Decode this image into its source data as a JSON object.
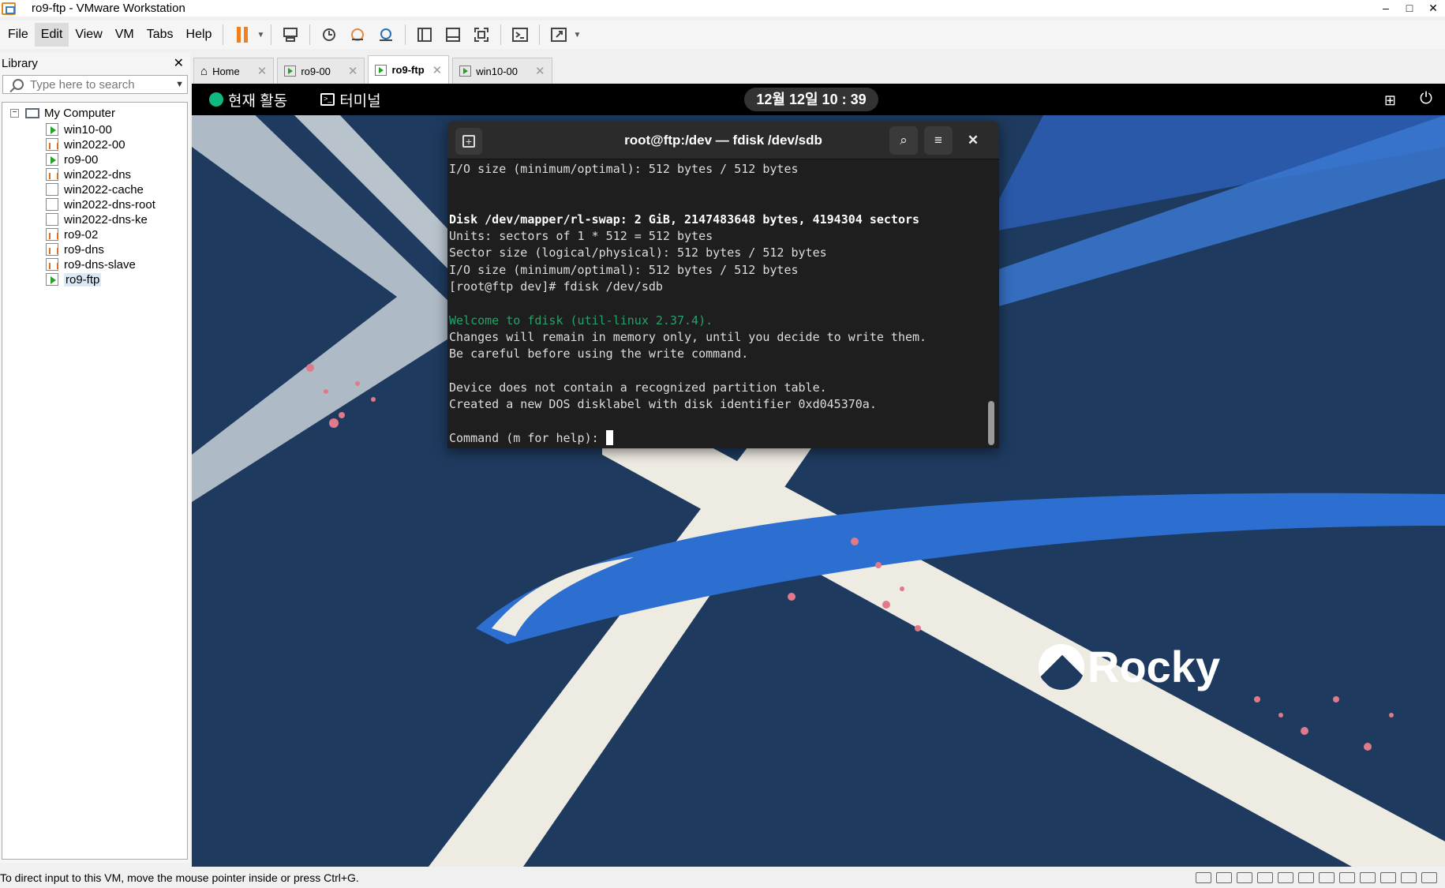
{
  "window": {
    "title": "ro9-ftp - VMware Workstation",
    "minimize": "–",
    "maximize": "□",
    "close": "✕"
  },
  "menu": [
    "File",
    "Edit",
    "View",
    "VM",
    "Tabs",
    "Help"
  ],
  "library": {
    "title": "Library",
    "close": "✕",
    "search_placeholder": "Type here to search",
    "root": "My Computer",
    "items": [
      {
        "label": "win10-00",
        "state": "running"
      },
      {
        "label": "win2022-00",
        "state": "off"
      },
      {
        "label": "ro9-00",
        "state": "running"
      },
      {
        "label": "win2022-dns",
        "state": "off"
      },
      {
        "label": "win2022-cache",
        "state": "none"
      },
      {
        "label": "win2022-dns-root",
        "state": "none"
      },
      {
        "label": "win2022-dns-ke",
        "state": "none"
      },
      {
        "label": "ro9-02",
        "state": "off"
      },
      {
        "label": "ro9-dns",
        "state": "off"
      },
      {
        "label": "ro9-dns-slave",
        "state": "off"
      },
      {
        "label": "ro9-ftp",
        "state": "running"
      }
    ]
  },
  "tabs": [
    {
      "label": "Home"
    },
    {
      "label": "ro9-00"
    },
    {
      "label": "ro9-ftp"
    },
    {
      "label": "win10-00"
    }
  ],
  "gnome": {
    "activities": "현재 활동",
    "app": "터미널",
    "clock": "12월 12일  10 : 39"
  },
  "terminal": {
    "title": "root@ftp:/dev — fdisk /dev/sdb",
    "lines": [
      {
        "text": "I/O size (minimum/optimal): 512 bytes / 512 bytes",
        "style": ""
      },
      {
        "text": "",
        "style": ""
      },
      {
        "text": "",
        "style": ""
      },
      {
        "text": "Disk /dev/mapper/rl-swap: 2 GiB, 2147483648 bytes, 4194304 sectors",
        "style": "bold"
      },
      {
        "text": "Units: sectors of 1 * 512 = 512 bytes",
        "style": ""
      },
      {
        "text": "Sector size (logical/physical): 512 bytes / 512 bytes",
        "style": ""
      },
      {
        "text": "I/O size (minimum/optimal): 512 bytes / 512 bytes",
        "style": ""
      },
      {
        "text": "[root@ftp dev]# fdisk /dev/sdb",
        "style": ""
      },
      {
        "text": "",
        "style": ""
      },
      {
        "text": "Welcome to fdisk (util-linux 2.37.4).",
        "style": "green"
      },
      {
        "text": "Changes will remain in memory only, until you decide to write them.",
        "style": ""
      },
      {
        "text": "Be careful before using the write command.",
        "style": ""
      },
      {
        "text": "",
        "style": ""
      },
      {
        "text": "Device does not contain a recognized partition table.",
        "style": ""
      },
      {
        "text": "Created a new DOS disklabel with disk identifier 0xd045370a.",
        "style": ""
      },
      {
        "text": "",
        "style": ""
      }
    ],
    "prompt": "Command (m for help): "
  },
  "wallpaper_logo": "Rocky",
  "status": {
    "message": "To direct input to this VM, move the mouse pointer inside or press Ctrl+G."
  },
  "colors": {
    "desktop": "#1e3a5f",
    "accent_green": "#26a269",
    "pause_orange": "#f08020"
  }
}
